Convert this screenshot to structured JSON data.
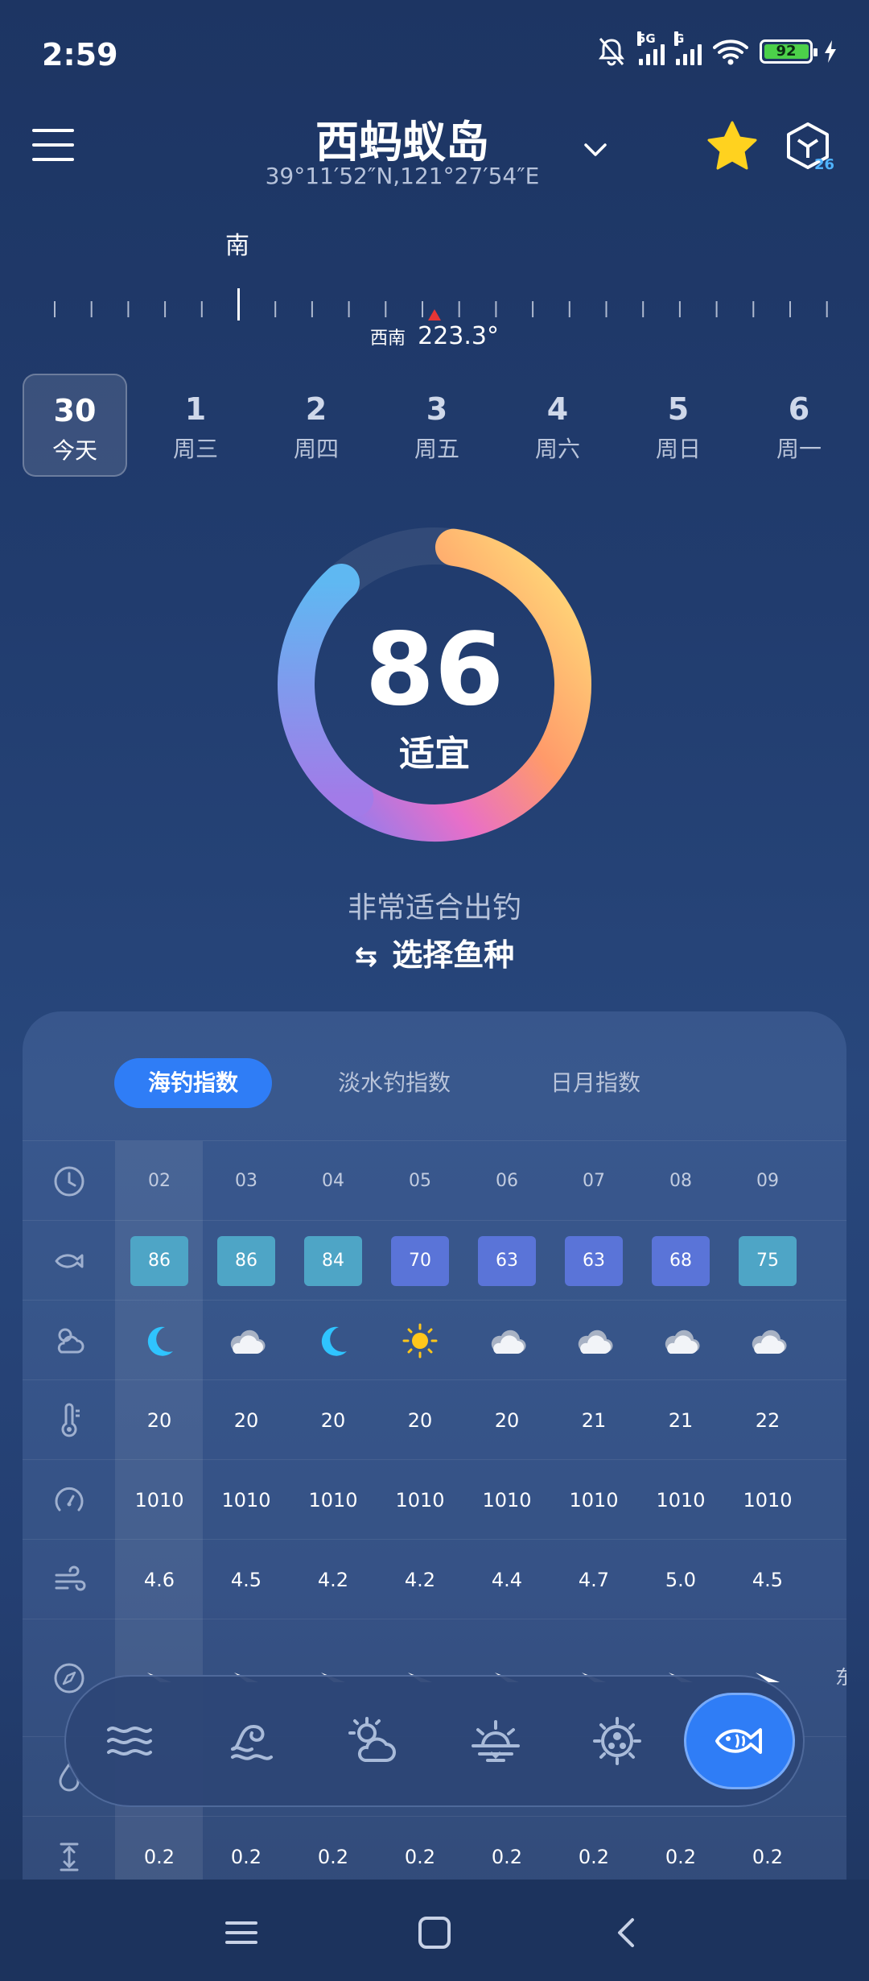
{
  "status": {
    "time": "2:59",
    "net1": "5G",
    "net2": "G",
    "battery": "92"
  },
  "header": {
    "title": "西蚂蚁岛",
    "coords": "39°11′52″N,121°27′54″E"
  },
  "compass": {
    "top_label": "南",
    "direction": "西南",
    "degrees": "223.3°"
  },
  "days": [
    {
      "num": "30",
      "label": "今天"
    },
    {
      "num": "1",
      "label": "周三"
    },
    {
      "num": "2",
      "label": "周四"
    },
    {
      "num": "3",
      "label": "周五"
    },
    {
      "num": "4",
      "label": "周六"
    },
    {
      "num": "5",
      "label": "周日"
    },
    {
      "num": "6",
      "label": "周一"
    }
  ],
  "gauge": {
    "score": "86",
    "label": "适宜",
    "value_fraction": 0.86,
    "description": "非常适合出钓",
    "select_fish": "选择鱼种"
  },
  "tabs": [
    "海钓指数",
    "淡水钓指数",
    "日月指数"
  ],
  "table": {
    "hours": [
      "02",
      "03",
      "04",
      "05",
      "06",
      "07",
      "08",
      "09"
    ],
    "scores": [
      "86",
      "86",
      "84",
      "70",
      "63",
      "63",
      "68",
      "75"
    ],
    "weather": [
      "moon-icon",
      "cloud-icon",
      "moon-icon",
      "sun-icon",
      "cloud-icon",
      "cloud-icon",
      "cloud-icon",
      "cloud-icon"
    ],
    "temperature": [
      "20",
      "20",
      "20",
      "20",
      "20",
      "21",
      "21",
      "22"
    ],
    "pressure": [
      "1010",
      "1010",
      "1010",
      "1010",
      "1010",
      "1010",
      "1010",
      "1010"
    ],
    "wind_speed": [
      "4.6",
      "4.5",
      "4.2",
      "4.2",
      "4.4",
      "4.7",
      "5.0",
      "4.5"
    ],
    "wave": [
      "0.2",
      "0.2",
      "0.2",
      "0.2",
      "0.2",
      "0.2",
      "0.2",
      "0.2"
    ],
    "wind_dir_partial": "东"
  },
  "colors": {
    "accent": "#2f7df6",
    "score_high": "#4ea5c6",
    "score_mid": "#5a74d8",
    "star": "#ffd21f"
  }
}
